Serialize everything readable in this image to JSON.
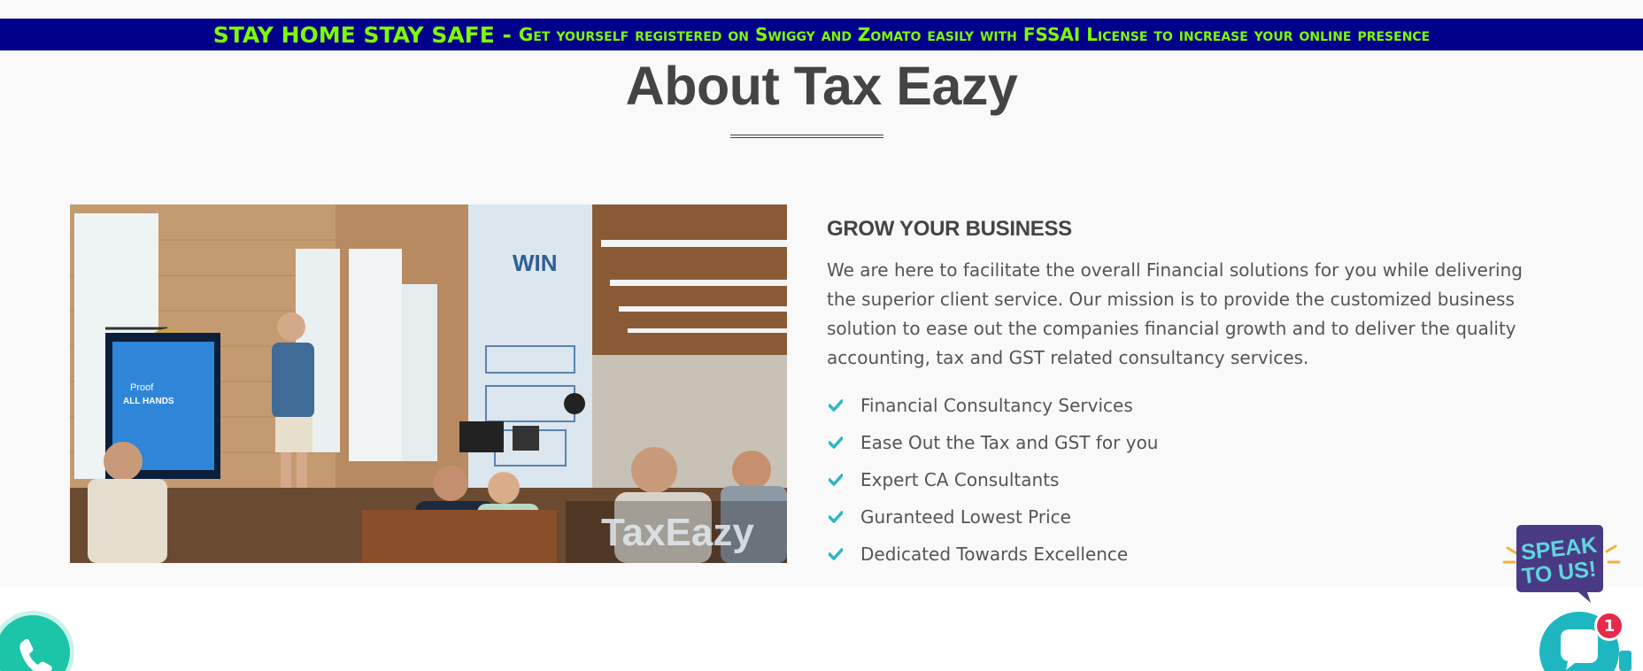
{
  "announcement": {
    "lead": "STAY HOME STAY SAFE -",
    "message": "Get yourself registered on Swiggy and Zomato easily with FSSAI License to increase your online presence"
  },
  "about": {
    "title": "About Tax Eazy",
    "image_watermark": "TaxEazy",
    "image_poster": {
      "win": "WIN",
      "screen_line1": "Proof",
      "screen_line2": "ALL HANDS"
    },
    "heading": "GROW YOUR BUSINESS",
    "intro": "We are here to facilitate the overall Financial solutions for you while delivering the superior client service. Our mission is to provide the customized business solution to ease out the companies financial growth and to deliver the quality accounting, tax and GST related consultancy services.",
    "features": [
      "Financial Consultancy Services",
      "Ease Out the Tax and GST for you",
      "Expert CA Consultants",
      "Guranteed Lowest Price",
      "Dedicated Towards Excellence"
    ]
  },
  "widgets": {
    "speak_line1": "SPEAK",
    "speak_line2": "TO US!",
    "chat_unread_count": "1"
  },
  "colors": {
    "banner_bg": "#00008b",
    "banner_text": "#7cfc00",
    "accent_teal": "#2fb5c0",
    "heading": "#444444",
    "phone_green": "#1cc5a7",
    "badge_red": "#e8294a"
  },
  "icons": [
    "check-icon",
    "phone-icon",
    "chat-icon"
  ]
}
